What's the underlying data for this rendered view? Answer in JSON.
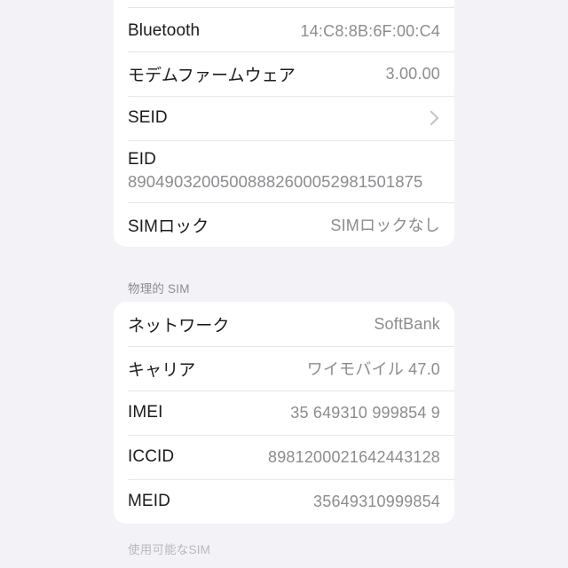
{
  "screen": {
    "background_color": "#f2f2f7",
    "card_color": "#ffffff",
    "label_color": "#1b1b1d",
    "value_color": "#8c8c90",
    "separator_color": "#e6e6e9"
  },
  "sections": [
    {
      "header": "",
      "rows": [
        {
          "label": "Bluetooth",
          "value": "14:C8:8B:6F:00:C4",
          "type": "value"
        },
        {
          "label": "モデムファームウェア",
          "value": "3.00.00",
          "type": "value"
        },
        {
          "label": "SEID",
          "value": "",
          "type": "disclosure",
          "icon": "chevron-right-icon"
        },
        {
          "label": "EID",
          "value": "89049032005008882600052981501875",
          "type": "stacked"
        },
        {
          "label": "SIMロック",
          "value": "SIMロックなし",
          "type": "value"
        }
      ]
    },
    {
      "header": "物理的 SIM",
      "rows": [
        {
          "label": "ネットワーク",
          "value": "SoftBank",
          "type": "value"
        },
        {
          "label": "キャリア",
          "value": "ワイモバイル 47.0",
          "type": "value"
        },
        {
          "label": "IMEI",
          "value": "35 649310 999854 9",
          "type": "value"
        },
        {
          "label": "ICCID",
          "value": "8981200021642443128",
          "type": "value"
        },
        {
          "label": "MEID",
          "value": "35649310999854",
          "type": "value"
        }
      ]
    },
    {
      "header": "使用可能なSIM",
      "rows": []
    }
  ]
}
